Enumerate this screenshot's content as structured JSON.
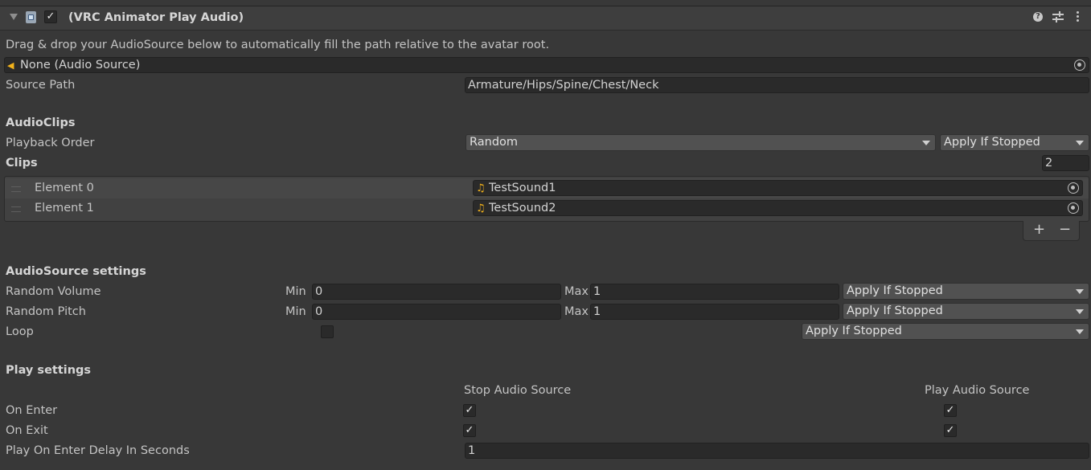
{
  "component": {
    "title": "(VRC Animator Play Audio)",
    "enabled": true,
    "fold_icon": "triangle-down-icon",
    "script_icon": "script-file-icon",
    "header_icons": [
      "help-icon",
      "preset-sliders-icon",
      "kebab-menu-icon"
    ]
  },
  "intro": {
    "hint": "Drag & drop your AudioSource below to automatically fill the path relative to the avatar root.",
    "audio_source_value": "None (Audio Source)"
  },
  "source_path": {
    "label": "Source Path",
    "value": "Armature/Hips/Spine/Chest/Neck"
  },
  "audioclips": {
    "heading": "AudioClips",
    "playback_order_label": "Playback Order",
    "playback_order": "Random",
    "playback_apply": "Apply If Stopped",
    "clips_label": "Clips",
    "clips_count": "2",
    "elements": [
      {
        "label": "Element 0",
        "value": "TestSound1"
      },
      {
        "label": "Element 1",
        "value": "TestSound2"
      }
    ],
    "add_label": "+",
    "remove_label": "−"
  },
  "audiosource_settings": {
    "heading": "AudioSource settings",
    "volume": {
      "label": "Random Volume",
      "min_label": "Min",
      "min": "0",
      "max_label": "Max",
      "max": "1",
      "apply": "Apply If Stopped"
    },
    "pitch": {
      "label": "Random Pitch",
      "min_label": "Min",
      "min": "0",
      "max_label": "Max",
      "max": "1",
      "apply": "Apply If Stopped"
    },
    "loop": {
      "label": "Loop",
      "checked": false,
      "apply": "Apply If Stopped"
    }
  },
  "play_settings": {
    "heading": "Play settings",
    "col_stop": "Stop Audio Source",
    "col_play": "Play Audio Source",
    "on_enter": {
      "label": "On Enter",
      "stop": true,
      "play": true
    },
    "on_exit": {
      "label": "On Exit",
      "stop": true,
      "play": true
    },
    "delay_label": "Play On Enter Delay In Seconds",
    "delay_value": "1"
  },
  "colors": {
    "background": "#383838",
    "field": "#2a2a2a",
    "dropdown": "#515151",
    "accent_icon": "#f2b21b",
    "text": "#c4c4c4"
  }
}
